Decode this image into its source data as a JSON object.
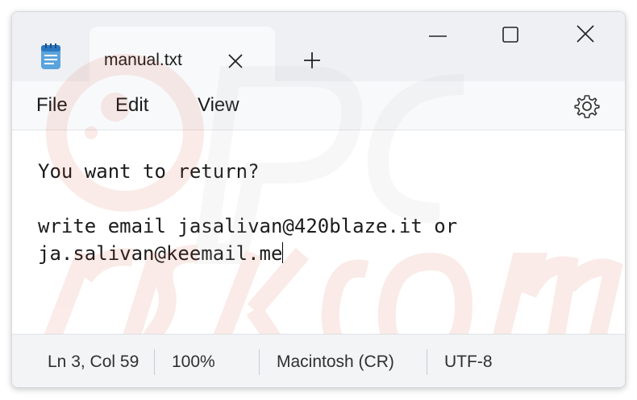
{
  "tab": {
    "title": "manual.txt"
  },
  "menu": {
    "file": "File",
    "edit": "Edit",
    "view": "View"
  },
  "editor": {
    "line1": "You want to return?",
    "line2": "",
    "line3": "write email jasalivan@420blaze.it or",
    "line4": "ja.salivan@keemail.me"
  },
  "status": {
    "position": "Ln 3, Col 59",
    "zoom": "100%",
    "line_ending": "Macintosh (CR)",
    "encoding": "UTF-8"
  },
  "icons": {
    "app": "notepad-icon",
    "tab_close": "close-icon",
    "new_tab": "plus-icon",
    "minimize": "minimize-icon",
    "maximize": "maximize-icon",
    "close": "close-icon",
    "settings": "gear-icon"
  },
  "colors": {
    "accent": "#1e66b8",
    "background": "#f8f9fa",
    "editor_bg": "#ffffff"
  }
}
